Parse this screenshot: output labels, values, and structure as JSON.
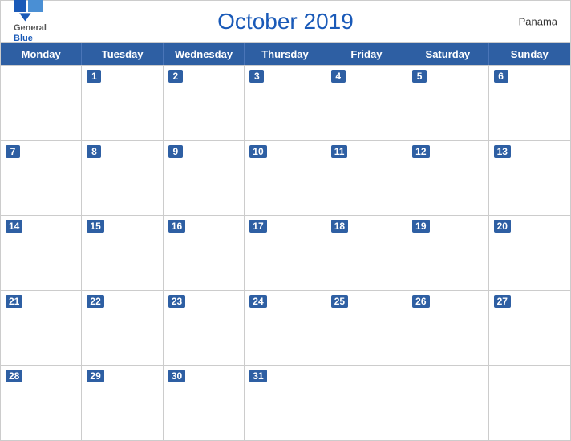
{
  "header": {
    "logo": {
      "general": "General",
      "blue": "Blue",
      "icon": "🔷"
    },
    "title": "October 2019",
    "country": "Panama"
  },
  "days_of_week": [
    "Monday",
    "Tuesday",
    "Wednesday",
    "Thursday",
    "Friday",
    "Saturday",
    "Sunday"
  ],
  "weeks": [
    [
      null,
      1,
      2,
      3,
      4,
      5,
      6
    ],
    [
      7,
      8,
      9,
      10,
      11,
      12,
      13
    ],
    [
      14,
      15,
      16,
      17,
      18,
      19,
      20
    ],
    [
      21,
      22,
      23,
      24,
      25,
      26,
      27
    ],
    [
      28,
      29,
      30,
      31,
      null,
      null,
      null
    ]
  ]
}
